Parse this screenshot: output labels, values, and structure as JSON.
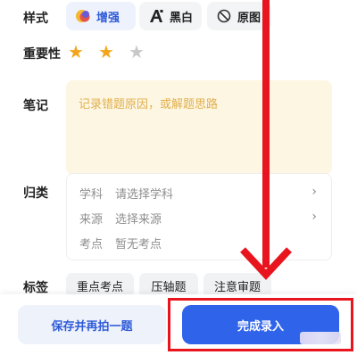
{
  "style": {
    "label": "样式",
    "options": [
      {
        "label": "增强",
        "icon": "enhance-icon",
        "active": true
      },
      {
        "label": "黑白",
        "icon": "bw-letter-a-icon",
        "active": false
      },
      {
        "label": "原图",
        "icon": "no-filter-icon",
        "active": false
      }
    ]
  },
  "importance": {
    "label": "重要性",
    "stars": [
      true,
      true,
      false
    ],
    "star_color_on": "#f3a51c",
    "star_color_off": "#c8c8c8"
  },
  "note": {
    "label": "笔记",
    "placeholder": "记录错题原因，或解题思路"
  },
  "category": {
    "label": "归类",
    "rows": [
      {
        "key": "学科",
        "value": "请选择学科",
        "chevron": true
      },
      {
        "key": "来源",
        "value": "选择来源",
        "chevron": true
      },
      {
        "key": "考点",
        "value": "暂无考点",
        "chevron": false
      }
    ]
  },
  "tags": {
    "label": "标签",
    "items": [
      "重点考点",
      "压轴题",
      "注意审题"
    ]
  },
  "actions": {
    "save_label": "保存并再拍一题",
    "done_label": "完成录入"
  },
  "colors": {
    "accent": "#2f63ea",
    "annotation": "#e8141e"
  }
}
